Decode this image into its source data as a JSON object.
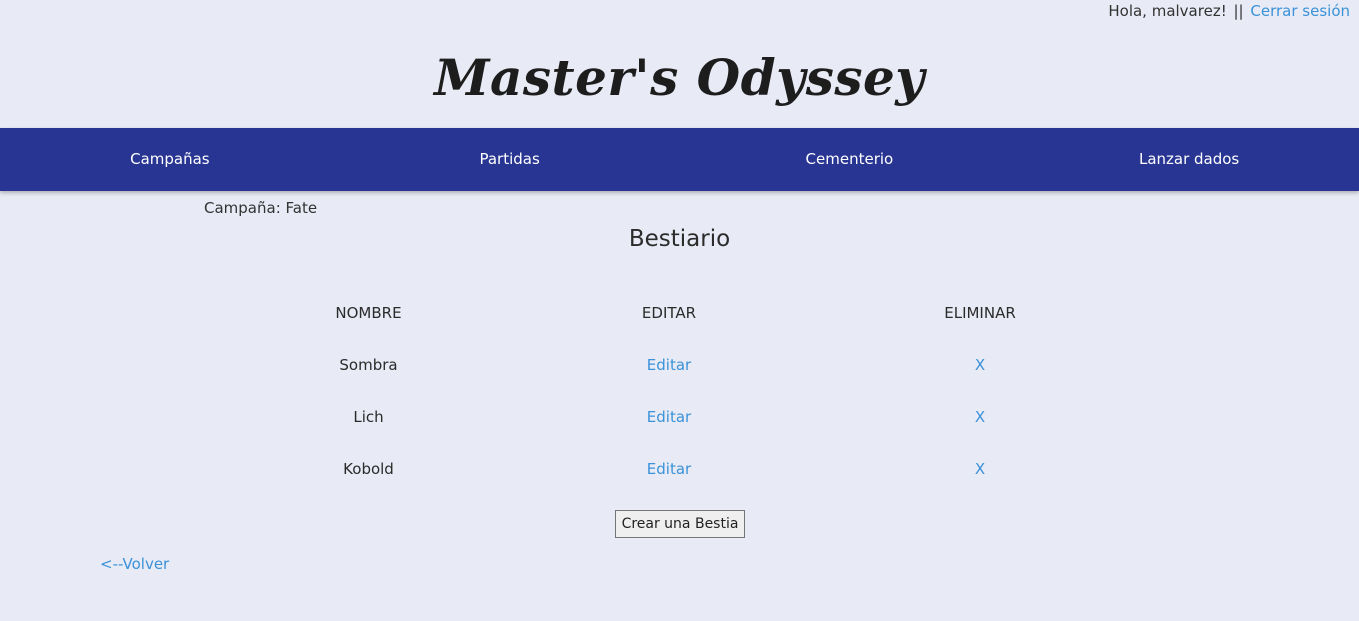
{
  "header": {
    "greeting": "Hola, malvarez!",
    "separator": "||",
    "logout_label": "Cerrar sesión",
    "brand_title": "Master's Odyssey"
  },
  "nav": {
    "items": [
      {
        "label": "Campañas"
      },
      {
        "label": "Partidas"
      },
      {
        "label": "Cementerio"
      },
      {
        "label": "Lanzar dados"
      }
    ]
  },
  "main": {
    "campaign_label": "Campaña: Fate",
    "title": "Bestiario",
    "table": {
      "headers": [
        "NOMBRE",
        "EDITAR",
        "ELIMINAR"
      ],
      "rows": [
        {
          "name": "Sombra",
          "edit": "Editar",
          "delete": "X"
        },
        {
          "name": "Lich",
          "edit": "Editar",
          "delete": "X"
        },
        {
          "name": "Kobold",
          "edit": "Editar",
          "delete": "X"
        }
      ]
    },
    "create_button": "Crear una Bestia",
    "back_link": "<--Volver"
  },
  "colors": {
    "background": "#e8eaf5",
    "navbar": "#283593",
    "link": "#3a92d8"
  }
}
